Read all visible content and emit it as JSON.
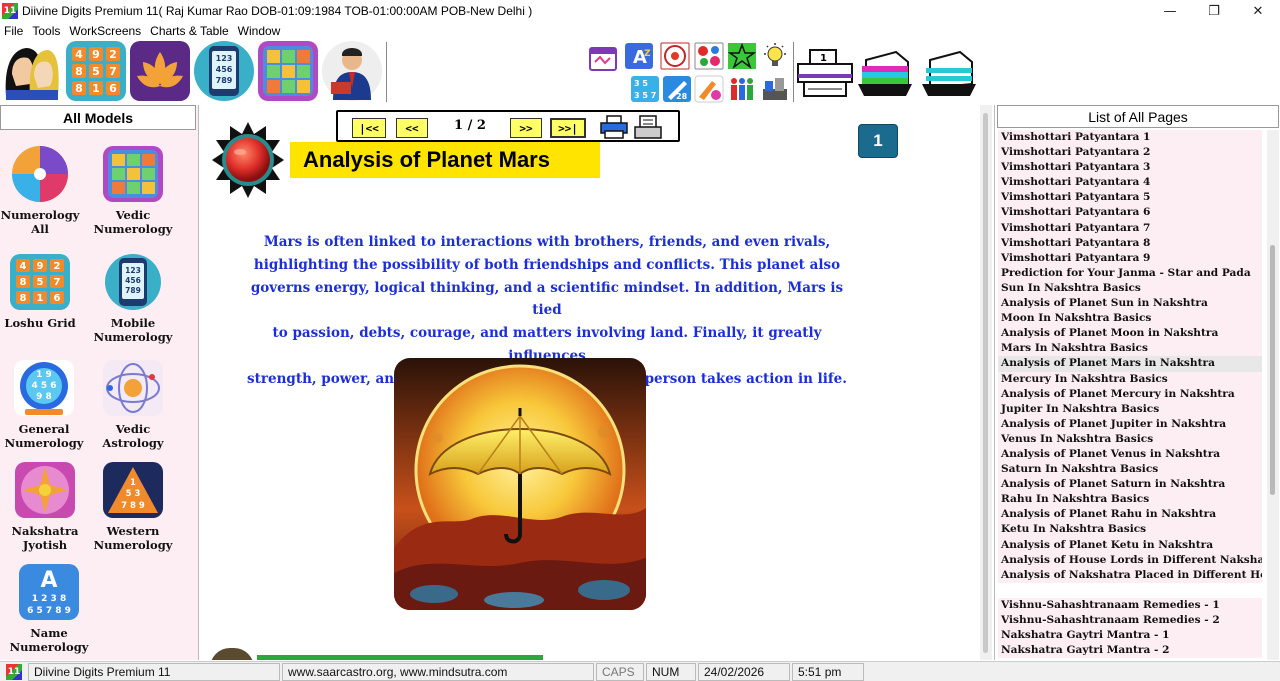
{
  "window": {
    "title": "Diivine Digits Premium 11( Raj Kumar Rao DOB-01:09:1984 TOB-01:00:00AM POB-New Delhi )",
    "minimize": "—",
    "maximize": "❐",
    "close": "✕"
  },
  "menu": [
    "File",
    "Tools",
    "WorkScreens",
    "Charts & Table",
    "Window"
  ],
  "left_panel": {
    "header": "All Models",
    "models": [
      {
        "line1": "Numerology",
        "line2": "All"
      },
      {
        "line1": "Vedic",
        "line2": "Numerology"
      },
      {
        "line1": "Loshu Grid",
        "line2": ""
      },
      {
        "line1": "Mobile",
        "line2": "Numerology"
      },
      {
        "line1": "General",
        "line2": "Numerology"
      },
      {
        "line1": "Vedic",
        "line2": "Astrology"
      },
      {
        "line1": "Nakshatra",
        "line2": "Jyotish"
      },
      {
        "line1": "Western",
        "line2": "Numerology"
      },
      {
        "line1": "Name",
        "line2": "Numerology"
      }
    ]
  },
  "navigation": {
    "first": "|<<",
    "prev": "<<",
    "page_indicator": "1 / 2",
    "next": ">>",
    "last": ">>|"
  },
  "content": {
    "page_badge": "1",
    "heading": "Analysis of Planet Mars",
    "paragraph_lines": [
      "Mars is often linked to interactions with brothers, friends, and even rivals,",
      "highlighting the possibility of both friendships and conflicts. This planet also",
      "governs energy, logical thinking, and a scientific mindset. In addition, Mars is tied",
      "to passion, debts, courage, and matters involving land. Finally, it greatly influences",
      "strength, power, and self-confidence, shaping how a person takes action in life."
    ]
  },
  "right_panel": {
    "header": "List of All Pages",
    "selected_index": 15,
    "pages": [
      "Vimshottari Patyantara 1",
      "Vimshottari Patyantara 2",
      "Vimshottari Patyantara 3",
      "Vimshottari Patyantara 4",
      "Vimshottari Patyantara 5",
      "Vimshottari Patyantara 6",
      "Vimshottari Patyantara 7",
      "Vimshottari Patyantara 8",
      "Vimshottari Patyantara 9",
      "Prediction for Your Janma - Star and Pada",
      "Sun In Nakshtra Basics",
      "Analysis of Planet Sun in Nakshtra",
      "Moon In Nakshtra Basics",
      "Analysis of Planet Moon in Nakshtra",
      "Mars In Nakshtra Basics",
      "Analysis of Planet Mars in Nakshtra",
      "Mercury In Nakshtra Basics",
      "Analysis of Planet Mercury in Nakshtra",
      "Jupiter In Nakshtra Basics",
      "Analysis of Planet Jupiter in Nakshtra",
      "Venus In Nakshtra Basics",
      "Analysis of Planet Venus in Nakshtra",
      "Saturn In Nakshtra Basics",
      "Analysis of Planet Saturn in Nakshtra",
      "Rahu In Nakshtra Basics",
      "Analysis of Planet Rahu in Nakshtra",
      "Ketu In Nakshtra Basics",
      "Analysis of Planet Ketu in Nakshtra",
      "Analysis of House Lords in Different Nakshatra",
      "Analysis of Nakshatra Placed in Different Houses",
      "",
      "Vishnu-Sahashtranaam Remedies - 1",
      "Vishnu-Sahashtranaam Remedies - 2",
      "Nakshatra Gaytri Mantra - 1",
      "Nakshatra Gaytri Mantra - 2"
    ]
  },
  "status": {
    "app_name": "Diivine Digits Premium 11",
    "websites": "www.saarcastro.org, www.mindsutra.com",
    "caps": "CAPS",
    "num": "NUM",
    "date": "24/02/2026",
    "time": "5:51 pm"
  },
  "colors": {
    "heading_bg": "#ffe400",
    "paragraph_text": "#1c2ed8",
    "nav_button": "#ffff66",
    "page_badge": "#1a6b8e",
    "list_bg": "#fdeef3"
  }
}
